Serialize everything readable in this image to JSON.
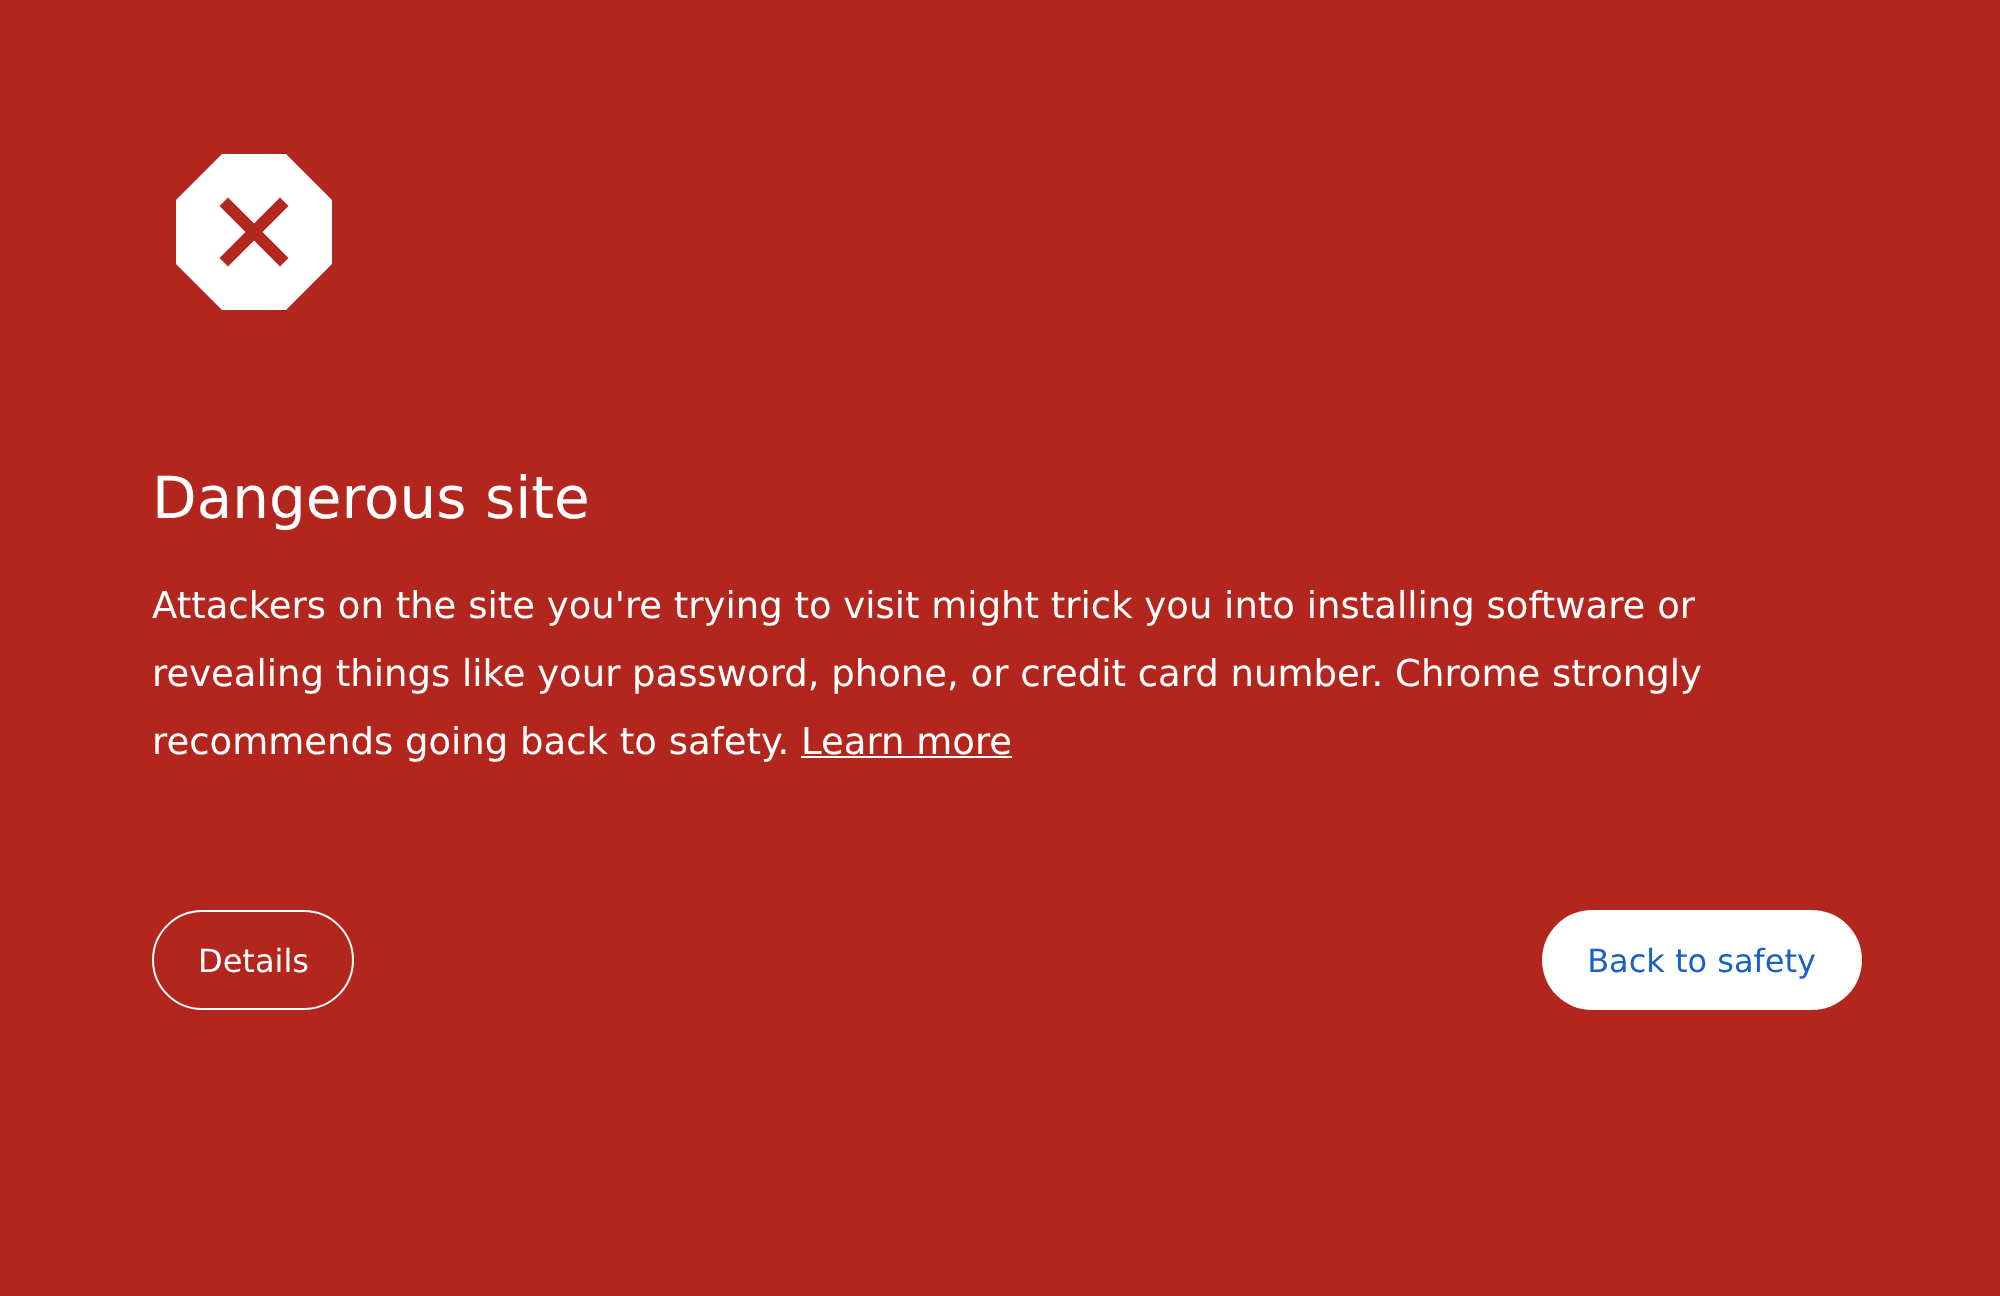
{
  "title": "Dangerous site",
  "message": {
    "text": "Attackers on the site you're trying to visit might trick you into installing software or revealing things like your password, phone, or credit card number. Chrome strongly recommends going back to safety.",
    "link": "Learn more"
  },
  "buttons": [
    {
      "label": "Details",
      "kind": "secondary"
    },
    {
      "label": "Back to safety",
      "kind": "primary"
    }
  ]
}
